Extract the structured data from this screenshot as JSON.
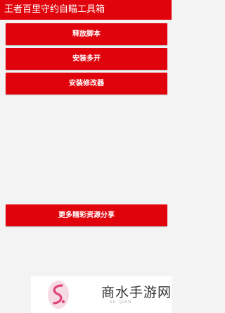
{
  "titlebar": {
    "title": "王者百里守约自瞄工具箱"
  },
  "buttons": {
    "release_script": "释放脚本",
    "install_multi": "安装多开",
    "install_modifier": "安装修改器",
    "more_resources": "更多精彩资源分享"
  },
  "watermark": {
    "logo_icon": "shangshui-logo-icon",
    "text": "商水手游网",
    "subtext": "SE QIAN",
    "brand_color": "#e0457b"
  },
  "colors": {
    "accent": "#e0030b",
    "background": "#f3f3f3"
  }
}
